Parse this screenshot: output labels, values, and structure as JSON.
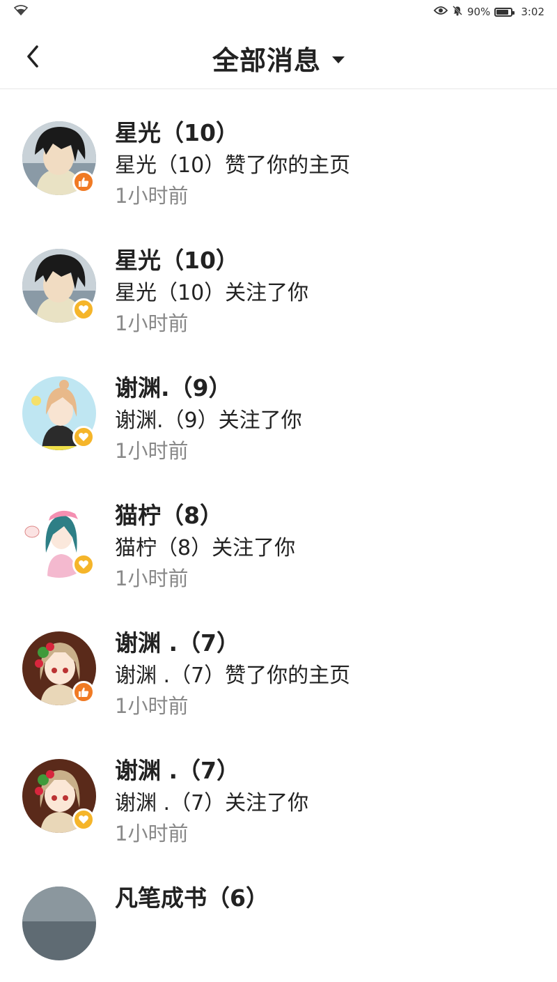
{
  "status_bar": {
    "battery_percent": "90%",
    "time": "3:02",
    "icons": [
      "wifi-icon",
      "eye-icon",
      "mute-bell-icon",
      "battery-icon"
    ]
  },
  "header": {
    "title": "全部消息",
    "back_icon": "chevron-left-icon",
    "dropdown_icon": "caret-down-icon"
  },
  "colors": {
    "like_badge": "#f07a24",
    "follow_badge": "#f5b52a",
    "time_text": "#888888"
  },
  "messages": [
    {
      "name": "星光（10）",
      "text": "星光（10）赞了你的主页",
      "time": "1小时前",
      "type": "like",
      "badge_icon": "thumbs-up-icon"
    },
    {
      "name": "星光（10）",
      "text": "星光（10）关注了你",
      "time": "1小时前",
      "type": "follow",
      "badge_icon": "heart-icon"
    },
    {
      "name": "谢渊.（9）",
      "text": "谢渊.（9）关注了你",
      "time": "1小时前",
      "type": "follow",
      "badge_icon": "heart-icon"
    },
    {
      "name": "猫柠（8）",
      "text": "猫柠（8）关注了你",
      "time": "1小时前",
      "type": "follow",
      "badge_icon": "heart-icon"
    },
    {
      "name": "谢渊 .（7）",
      "text": "谢渊 .（7）赞了你的主页",
      "time": "1小时前",
      "type": "like",
      "badge_icon": "thumbs-up-icon"
    },
    {
      "name": "谢渊 .（7）",
      "text": "谢渊 .（7）关注了你",
      "time": "1小时前",
      "type": "follow",
      "badge_icon": "heart-icon"
    },
    {
      "name": "凡笔成书（6）",
      "text": "",
      "time": "",
      "type": "",
      "badge_icon": ""
    }
  ]
}
